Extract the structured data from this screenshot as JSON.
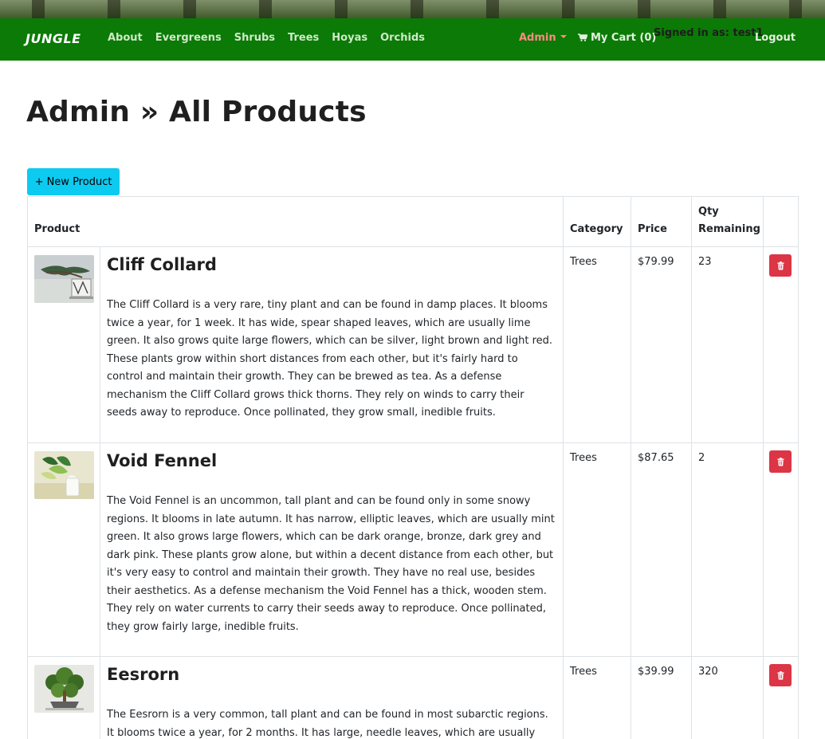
{
  "navbar": {
    "brand": "JUNGLE",
    "links": [
      "About",
      "Evergreens",
      "Shrubs",
      "Trees",
      "Hoyas",
      "Orchids"
    ],
    "admin_label": "Admin",
    "cart_label": "My Cart (0)",
    "signed_in": "Signed in as: test1",
    "logout": "Logout",
    "icons": {
      "cart": "cart-icon",
      "admin_dropdown": "chevron-down-icon"
    }
  },
  "page": {
    "title": "Admin » All Products",
    "new_button": "+ New Product"
  },
  "table": {
    "headers": {
      "product": "Product",
      "category": "Category",
      "price": "Price",
      "qty": "Qty Remaining"
    },
    "rows": [
      {
        "name": "Cliff Collard",
        "description": "The Cliff Collard is a very rare, tiny plant and can be found in damp places. It blooms twice a year, for 1 week. It has wide, spear shaped leaves, which are usually lime green. It also grows quite large flowers, which can be silver, light brown and light red. These plants grow within short distances from each other, but it's fairly hard to control and maintain their growth. They can be brewed as tea. As a defense mechanism the Cliff Collard grows thick thorns. They rely on winds to carry their seeds away to reproduce. Once pollinated, they grow small, inedible fruits.",
        "category": "Trees",
        "price": "$79.99",
        "qty": "23"
      },
      {
        "name": "Void Fennel",
        "description": "The Void Fennel is an uncommon, tall plant and can be found only in some snowy regions. It blooms in late autumn. It has narrow, elliptic leaves, which are usually mint green. It also grows large flowers, which can be dark orange, bronze, dark grey and dark pink. These plants grow alone, but within a decent distance from each other, but it's very easy to control and maintain their growth. They have no real use, besides their aesthetics. As a defense mechanism the Void Fennel has a thick, wooden stem. They rely on water currents to carry their seeds away to reproduce. Once pollinated, they grow fairly large, inedible fruits.",
        "category": "Trees",
        "price": "$87.65",
        "qty": "2"
      },
      {
        "name": "Eesrorn",
        "description": "The Eesrorn is a very common, tall plant and can be found in most subarctic regions. It blooms twice a year, for 2 months. It has large, needle leaves, which are usually light",
        "category": "Trees",
        "price": "$39.99",
        "qty": "320"
      }
    ],
    "delete_icon": "trash-icon",
    "colors": {
      "delete": "#dc3545",
      "new_button": "#0dcaf0",
      "navbar": "#0b7a06"
    }
  }
}
